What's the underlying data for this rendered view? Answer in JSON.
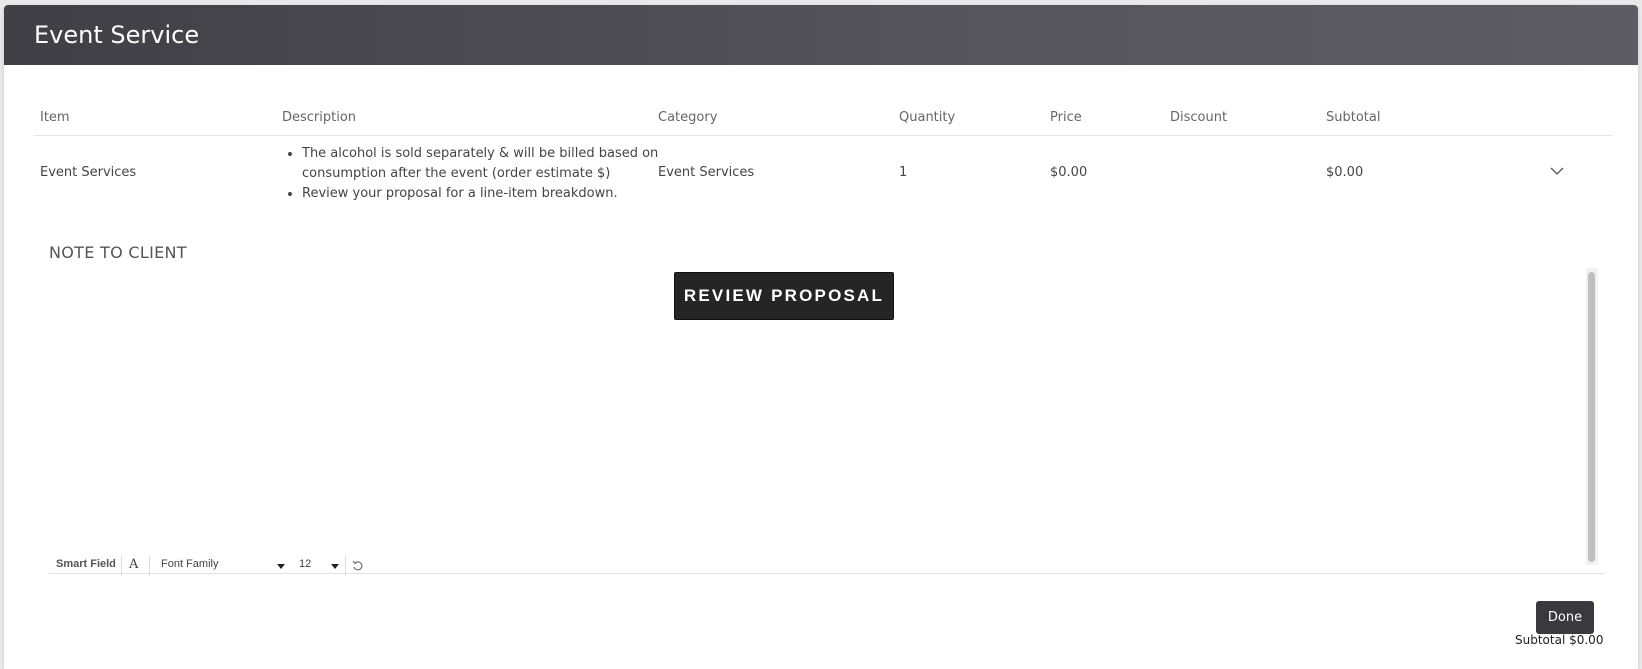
{
  "modal": {
    "title": "Event Service"
  },
  "table": {
    "headers": {
      "item": "Item",
      "description": "Description",
      "category": "Category",
      "quantity": "Quantity",
      "price": "Price",
      "discount": "Discount",
      "subtotal": "Subtotal"
    },
    "rows": [
      {
        "item": "Event Services",
        "description": [
          "The alcohol is sold separately & will be billed based on consumption after the event (order estimate $)",
          "Review your proposal for a line-item breakdown."
        ],
        "category": "Event Services",
        "quantity": "1",
        "price": "$0.00",
        "discount": "",
        "subtotal": "$0.00",
        "expand_icon": "chevron-down-icon"
      }
    ]
  },
  "note": {
    "label": "NOTE TO CLIENT",
    "review_button_label": "REVIEW PROPOSAL"
  },
  "editor_toolbar": {
    "smart_field_label": "Smart Field",
    "text_icon": "A",
    "font_family_value": "Font Family",
    "font_size_value": "12",
    "undo_icon": "undo-icon"
  },
  "footer": {
    "done_label": "Done",
    "subtotal_partial": "Subtotal $0.00"
  },
  "colors": {
    "header_bg": "#4a4a50",
    "button_dark": "#252525"
  }
}
